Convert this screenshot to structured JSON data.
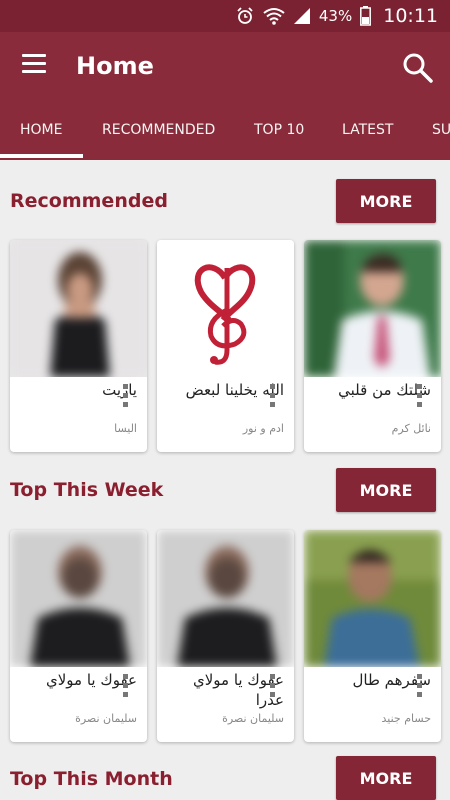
{
  "status": {
    "battery": "43%",
    "time": "10:11"
  },
  "appbar": {
    "title": "Home"
  },
  "tabs": [
    "HOME",
    "RECOMMENDED",
    "TOP 10",
    "LATEST",
    "SU"
  ],
  "sections": [
    {
      "title": "Recommended",
      "more": "MORE",
      "cards": [
        {
          "song": "ياريت",
          "artist": "اليسا"
        },
        {
          "song": "الله يخلينا لبعض",
          "artist": "ادم و نور"
        },
        {
          "song": "شلتك من قلبي",
          "artist": "نائل كرم"
        }
      ]
    },
    {
      "title": "Top This Week",
      "more": "MORE",
      "cards": [
        {
          "song": "عفوك يا مولاي",
          "artist": "سليمان نصرة"
        },
        {
          "song": "عفوك يا مولاي عدرا",
          "artist": "سليمان نصرة"
        },
        {
          "song": "سفرهم طال",
          "artist": "حسام جنيد"
        }
      ]
    },
    {
      "title": "Top This Month",
      "more": "MORE"
    }
  ],
  "colors": {
    "primary": "#892b3a",
    "statusbar": "#7a2232",
    "accent_text": "#8a1f30"
  }
}
